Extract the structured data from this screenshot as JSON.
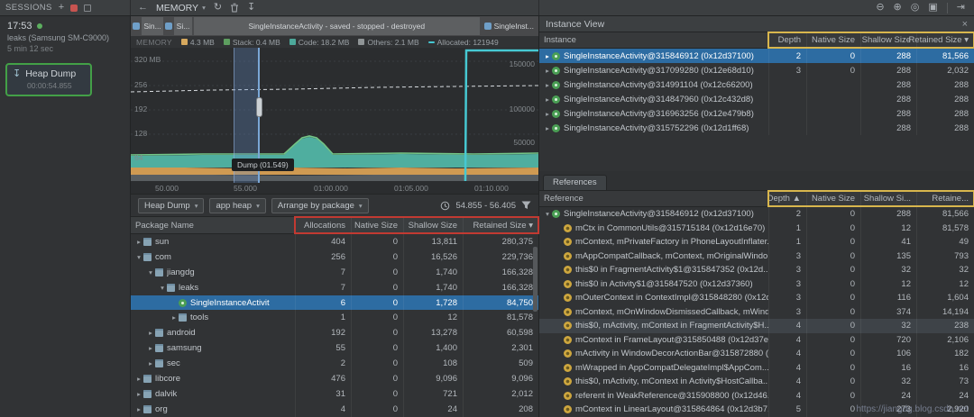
{
  "window": {
    "watermark": "https://jiangdg.blog.csdn.net"
  },
  "icons": {
    "back": "←",
    "caret": "▾",
    "gc": "↻",
    "capture": "↧",
    "zoom_out": "⊖",
    "zoom_in": "⊕",
    "reset_zoom": "◎",
    "zoom_selection": "▣",
    "go_live": "⇥",
    "close": "×",
    "plus": "+",
    "heap_dump": "↧"
  },
  "topbar": {
    "sessions_title": "SESSIONS",
    "memory_label": "MEMORY"
  },
  "sessions_panel": {
    "session_time": "17:53",
    "session_name": "leaks (Samsung SM-C9000)",
    "session_duration": "5 min 12 sec",
    "heap_dump_label": "Heap Dump",
    "heap_dump_time": "00:00:54.855"
  },
  "memory_panel": {
    "activity_segments": {
      "seg1": "Sin...",
      "seg2": "Si...",
      "seg3": "SingleInstanceActivity - saved - stopped - destroyed",
      "seg4": "SingleInst..."
    },
    "stage_label": "MEMORY",
    "legend": [
      {
        "label": "4.3 MB",
        "swatch": "orange"
      },
      {
        "label": "Stack: 0.4 MB",
        "swatch": "green"
      },
      {
        "label": "Code: 18.2 MB",
        "swatch": "teal"
      },
      {
        "label": "Others: 2.1 MB",
        "swatch": "gray"
      },
      {
        "label": "Allocated: 121949",
        "swatch": "cyan"
      }
    ],
    "y_left": [
      "320 MB",
      "256",
      "192",
      "128",
      "64"
    ],
    "y_right": [
      "150000",
      "100000",
      "50000"
    ],
    "x_ticks": [
      "50.000",
      "55.000",
      "01:00.000",
      "01:05.000",
      "01:10.000"
    ],
    "dump_tooltip": "Dump (01.549)",
    "toolbar": {
      "heap_combo": "Heap Dump",
      "scope_combo": "app heap",
      "arrange_combo": "Arrange by package",
      "time_range": "54.855 - 56.405"
    },
    "table": {
      "col_name": "Package Name",
      "col_alloc": "Allocations",
      "col_native": "Native Size",
      "col_shallow": "Shallow Size",
      "col_retained": "Retained Size ▾",
      "rows": [
        {
          "arrow": "▸",
          "ind": "ind0",
          "icon": "package",
          "name": "sun",
          "alloc": "404",
          "native": "0",
          "shallow": "13,811",
          "retained": "280,375"
        },
        {
          "arrow": "▾",
          "ind": "ind0",
          "icon": "package",
          "name": "com",
          "alloc": "256",
          "native": "0",
          "shallow": "16,526",
          "retained": "229,736"
        },
        {
          "arrow": "▾",
          "ind": "ind1",
          "icon": "package",
          "name": "jiangdg",
          "alloc": "7",
          "native": "0",
          "shallow": "1,740",
          "retained": "166,328"
        },
        {
          "arrow": "▾",
          "ind": "ind2",
          "icon": "package",
          "name": "leaks",
          "alloc": "7",
          "native": "0",
          "shallow": "1,740",
          "retained": "166,328"
        },
        {
          "arrow": "",
          "ind": "ind3",
          "icon": "class",
          "name": "SingleInstanceActivit",
          "alloc": "6",
          "native": "0",
          "shallow": "1,728",
          "retained": "84,750",
          "state": "sel"
        },
        {
          "arrow": "▸",
          "ind": "ind3",
          "icon": "package",
          "name": "tools",
          "alloc": "1",
          "native": "0",
          "shallow": "12",
          "retained": "81,578"
        },
        {
          "arrow": "▸",
          "ind": "ind1",
          "icon": "package",
          "name": "android",
          "alloc": "192",
          "native": "0",
          "shallow": "13,278",
          "retained": "60,598"
        },
        {
          "arrow": "▸",
          "ind": "ind1",
          "icon": "package",
          "name": "samsung",
          "alloc": "55",
          "native": "0",
          "shallow": "1,400",
          "retained": "2,301"
        },
        {
          "arrow": "▸",
          "ind": "ind1",
          "icon": "package",
          "name": "sec",
          "alloc": "2",
          "native": "0",
          "shallow": "108",
          "retained": "509"
        },
        {
          "arrow": "▸",
          "ind": "ind0",
          "icon": "package",
          "name": "libcore",
          "alloc": "476",
          "native": "0",
          "shallow": "9,096",
          "retained": "9,096"
        },
        {
          "arrow": "▸",
          "ind": "ind0",
          "icon": "package",
          "name": "dalvik",
          "alloc": "31",
          "native": "0",
          "shallow": "721",
          "retained": "2,012"
        },
        {
          "arrow": "▸",
          "ind": "ind0",
          "icon": "package",
          "name": "org",
          "alloc": "4",
          "native": "0",
          "shallow": "24",
          "retained": "208"
        }
      ]
    }
  },
  "instance_panel": {
    "title": "Instance View",
    "references_tab": "References",
    "instance": {
      "col_tree": "Instance",
      "col_depth": "Depth",
      "col_native": "Native Size",
      "col_shallow": "Shallow Size",
      "col_retained": "Retained Size ▾",
      "rows": [
        {
          "arrow": "▸",
          "ind": "ind0",
          "icon": "instance",
          "name": "SingleInstanceActivity@315846912 (0x12d37100)",
          "depth": "2",
          "native": "0",
          "shallow": "288",
          "retained": "81,566",
          "state": "sel"
        },
        {
          "arrow": "▸",
          "ind": "ind0",
          "icon": "instance",
          "name": "SingleInstanceActivity@317099280 (0x12e68d10)",
          "depth": "3",
          "native": "0",
          "shallow": "288",
          "retained": "2,032"
        },
        {
          "arrow": "▸",
          "ind": "ind0",
          "icon": "instance",
          "name": "SingleInstanceActivity@314991104 (0x12c66200)",
          "depth": "",
          "native": "",
          "shallow": "288",
          "retained": "288"
        },
        {
          "arrow": "▸",
          "ind": "ind0",
          "icon": "instance",
          "name": "SingleInstanceActivity@314847960 (0x12c432d8)",
          "depth": "",
          "native": "",
          "shallow": "288",
          "retained": "288"
        },
        {
          "arrow": "▸",
          "ind": "ind0",
          "icon": "instance",
          "name": "SingleInstanceActivity@316963256 (0x12e479b8)",
          "depth": "",
          "native": "",
          "shallow": "288",
          "retained": "288"
        },
        {
          "arrow": "▸",
          "ind": "ind0",
          "icon": "instance",
          "name": "SingleInstanceActivity@315752296 (0x12d1ff68)",
          "depth": "",
          "native": "",
          "shallow": "288",
          "retained": "288"
        }
      ]
    },
    "reference": {
      "col_tree": "Reference",
      "col_depth": "Depth ▲",
      "col_native": "Native Size",
      "col_shallow": "Shallow Si...",
      "col_retained": "Retaine...",
      "rows": [
        {
          "arrow": "▾",
          "ind": "ind0",
          "icon": "instance",
          "name": "SingleInstanceActivity@315846912 (0x12d37100)",
          "depth": "2",
          "native": "0",
          "shallow": "288",
          "retained": "81,566"
        },
        {
          "arrow": "",
          "ind": "ind1",
          "icon": "field",
          "name": "mCtx in CommonUtils@315715184 (0x12d16e70)",
          "depth": "1",
          "native": "0",
          "shallow": "12",
          "retained": "81,578"
        },
        {
          "arrow": "",
          "ind": "ind1",
          "icon": "field",
          "name": "mContext, mPrivateFactory in PhoneLayoutInflater...",
          "depth": "1",
          "native": "0",
          "shallow": "41",
          "retained": "49"
        },
        {
          "arrow": "",
          "ind": "ind1",
          "icon": "field",
          "name": "mAppCompatCallback, mContext, mOriginalWindo...",
          "depth": "3",
          "native": "0",
          "shallow": "135",
          "retained": "793"
        },
        {
          "arrow": "",
          "ind": "ind1",
          "icon": "field",
          "name": "this$0 in FragmentActivity$1@315847352 (0x12d...",
          "depth": "3",
          "native": "0",
          "shallow": "32",
          "retained": "32"
        },
        {
          "arrow": "",
          "ind": "ind1",
          "icon": "field",
          "name": "this$0 in Activity$1@315847520 (0x12d37360)",
          "depth": "3",
          "native": "0",
          "shallow": "12",
          "retained": "12"
        },
        {
          "arrow": "",
          "ind": "ind1",
          "icon": "field",
          "name": "mOuterContext in ContextImpl@315848280 (0x12d...",
          "depth": "3",
          "native": "0",
          "shallow": "116",
          "retained": "1,604"
        },
        {
          "arrow": "",
          "ind": "ind1",
          "icon": "field",
          "name": "mContext, mOnWindowDismissedCallback, mWind...",
          "depth": "3",
          "native": "0",
          "shallow": "374",
          "retained": "14,194"
        },
        {
          "arrow": "",
          "ind": "ind1",
          "icon": "field",
          "name": "this$0, mActivity, mContext in FragmentActivity$H...",
          "depth": "4",
          "native": "0",
          "shallow": "32",
          "retained": "238",
          "state": "hov"
        },
        {
          "arrow": "",
          "ind": "ind1",
          "icon": "field",
          "name": "mContext in FrameLayout@315850488 (0x12d37e...",
          "depth": "4",
          "native": "0",
          "shallow": "720",
          "retained": "2,106"
        },
        {
          "arrow": "",
          "ind": "ind1",
          "icon": "field",
          "name": "mActivity in WindowDecorActionBar@315872880 (...",
          "depth": "4",
          "native": "0",
          "shallow": "106",
          "retained": "182"
        },
        {
          "arrow": "",
          "ind": "ind1",
          "icon": "field",
          "name": "mWrapped in AppCompatDelegateImpl$AppCom...",
          "depth": "4",
          "native": "0",
          "shallow": "16",
          "retained": "16"
        },
        {
          "arrow": "",
          "ind": "ind1",
          "icon": "field",
          "name": "this$0, mActivity, mContext in Activity$HostCallba...",
          "depth": "4",
          "native": "0",
          "shallow": "32",
          "retained": "73"
        },
        {
          "arrow": "",
          "ind": "ind1",
          "icon": "field",
          "name": "referent in WeakReference@315908800 (0x12d46...",
          "depth": "4",
          "native": "0",
          "shallow": "24",
          "retained": "24"
        },
        {
          "arrow": "",
          "ind": "ind1",
          "icon": "field",
          "name": "mContext in LinearLayout@315864864 (0x12d3b7...",
          "depth": "5",
          "native": "0",
          "shallow": "273",
          "retained": "2,920"
        }
      ]
    }
  }
}
